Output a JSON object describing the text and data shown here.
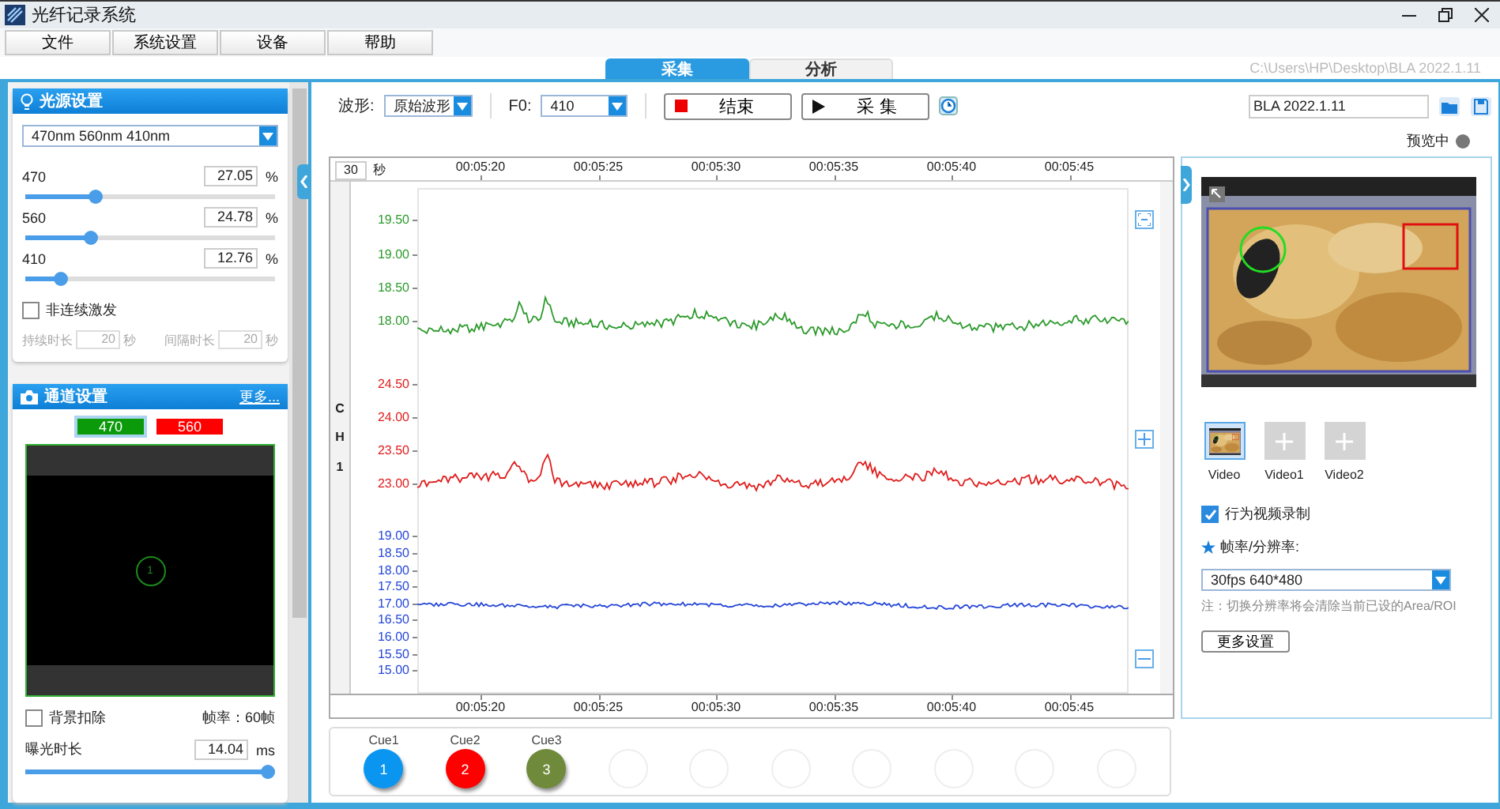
{
  "window": {
    "title": "光纤记录系统"
  },
  "menu": [
    "文件",
    "系统设置",
    "设备",
    "帮助"
  ],
  "tabs": [
    {
      "label": "采集",
      "selected": true
    },
    {
      "label": "分析",
      "selected": false
    }
  ],
  "path": "C:\\Users\\HP\\Desktop\\BLA 2022.1.11",
  "light_panel": {
    "title": "光源设置",
    "wavelengths": "470nm  560nm  410nm",
    "sliders": [
      {
        "name": "470",
        "value": "27.05",
        "unit": "%",
        "level": 0.28
      },
      {
        "name": "560",
        "value": "24.78",
        "unit": "%",
        "level": 0.26
      },
      {
        "name": "410",
        "value": "12.76",
        "unit": "%",
        "level": 0.14
      }
    ],
    "pulse": {
      "label": "非连续激发",
      "checked": false
    },
    "timing": {
      "disabled": true,
      "fields": [
        {
          "label": "持续时长",
          "value": "20",
          "unit": "秒"
        },
        {
          "label": "间隔时长",
          "value": "20",
          "unit": "秒"
        }
      ]
    }
  },
  "channel_panel": {
    "title": "通道设置",
    "more": "更多...",
    "channels": [
      {
        "label": "470",
        "color": "#0a9a0a",
        "selected": true
      },
      {
        "label": "560",
        "color": "#ff0000",
        "selected": false
      }
    ],
    "roi": "1",
    "background": {
      "label": "背景扣除",
      "checked": false
    },
    "frame_rate": "帧率：60帧",
    "exposure": {
      "label": "曝光时长",
      "value": "14.04",
      "unit": "ms",
      "level": 0.97
    }
  },
  "toolbar": {
    "waveform_label": "波形:",
    "waveform": "原始波形",
    "f0_label": "F0:",
    "f0": "410",
    "stop": "结束",
    "acquire": "采 集",
    "file_name": "BLA 2022.1.11",
    "preview": "预览中"
  },
  "chart": {
    "window_value": "30",
    "window_unit": "秒",
    "channel": "CH1",
    "time_ticks": [
      "00:05:20",
      "00:05:25",
      "00:05:30",
      "00:05:35",
      "00:05:40",
      "00:05:45"
    ],
    "bottom_time_ticks": [
      "00:05:20",
      "00:05:25",
      "00:05:30",
      "00:05:35",
      "00:05:40",
      "00:05:45"
    ],
    "traces": [
      {
        "color": "#2c9a2c",
        "ticks": [
          "19.50",
          "19.00",
          "18.50",
          "18.00"
        ]
      },
      {
        "color": "#e01c1c",
        "ticks": [
          "24.50",
          "24.00",
          "23.50",
          "23.00"
        ]
      },
      {
        "color": "#2647d8",
        "ticks": [
          "19.00",
          "18.50",
          "18.00",
          "17.50",
          "17.00",
          "16.50",
          "16.00",
          "15.50",
          "15.00"
        ]
      }
    ]
  },
  "cues": [
    {
      "kind": "cue",
      "label": "Cue1",
      "number": "1",
      "color": "#0a96f0"
    },
    {
      "kind": "cue",
      "label": "Cue2",
      "number": "2",
      "color": "#ff0000"
    },
    {
      "kind": "cue",
      "label": "Cue3",
      "number": "3",
      "color": "#6e8a3a"
    },
    {
      "kind": "empty"
    },
    {
      "kind": "empty"
    },
    {
      "kind": "empty"
    },
    {
      "kind": "empty"
    },
    {
      "kind": "empty"
    },
    {
      "kind": "empty"
    },
    {
      "kind": "empty"
    }
  ],
  "video_panel": {
    "sources": [
      {
        "label": "Video",
        "kind": "camera",
        "selected": true
      },
      {
        "label": "Video1",
        "kind": "add",
        "selected": false
      },
      {
        "label": "Video2",
        "kind": "add",
        "selected": false
      }
    ],
    "record": {
      "label": "行为视频录制",
      "checked": true
    },
    "fps_label": "帧率/分辨率:",
    "fps": "30fps    640*480",
    "note": "注：切换分辨率将会清除当前已设的Area/ROI",
    "more_button": "更多设置"
  }
}
